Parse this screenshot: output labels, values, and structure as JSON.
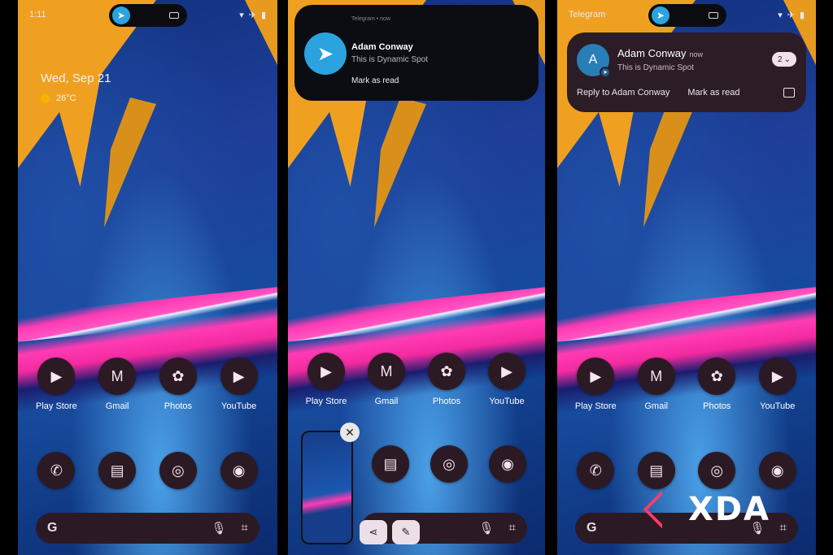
{
  "phone1": {
    "status_time": "1:11",
    "date": "Wed, Sep 21",
    "weather_temp": "26°C",
    "apps_row1": [
      {
        "label": "Play Store",
        "icon": "▶"
      },
      {
        "label": "Gmail",
        "icon": "M"
      },
      {
        "label": "Photos",
        "icon": "✿"
      },
      {
        "label": "YouTube",
        "icon": "▶"
      }
    ],
    "apps_row2": [
      {
        "icon": "✆"
      },
      {
        "icon": "▤"
      },
      {
        "icon": "◎"
      },
      {
        "icon": "◉"
      }
    ],
    "search_g": "G"
  },
  "phone2": {
    "notification": {
      "meta": "Telegram • now",
      "title": "Adam Conway",
      "body": "This is Dynamic Spot",
      "action": "Mark as read"
    },
    "apps_row1": [
      {
        "label": "Play Store"
      },
      {
        "label": "Gmail"
      },
      {
        "label": "Photos"
      },
      {
        "label": "YouTube"
      }
    ],
    "screenshot_close": "✕",
    "share_icon": "⋖",
    "edit_icon": "✎"
  },
  "phone3": {
    "status_app": "Telegram",
    "notification": {
      "avatar_letter": "A",
      "title": "Adam Conway",
      "time": "now",
      "body": "This is Dynamic Spot",
      "count": "2",
      "action_reply": "Reply to Adam Conway",
      "action_read": "Mark as read"
    },
    "apps_row1": [
      {
        "label": "Play Store"
      },
      {
        "label": "Gmail"
      },
      {
        "label": "Photos"
      },
      {
        "label": "YouTube"
      }
    ]
  },
  "watermark": "XDA"
}
